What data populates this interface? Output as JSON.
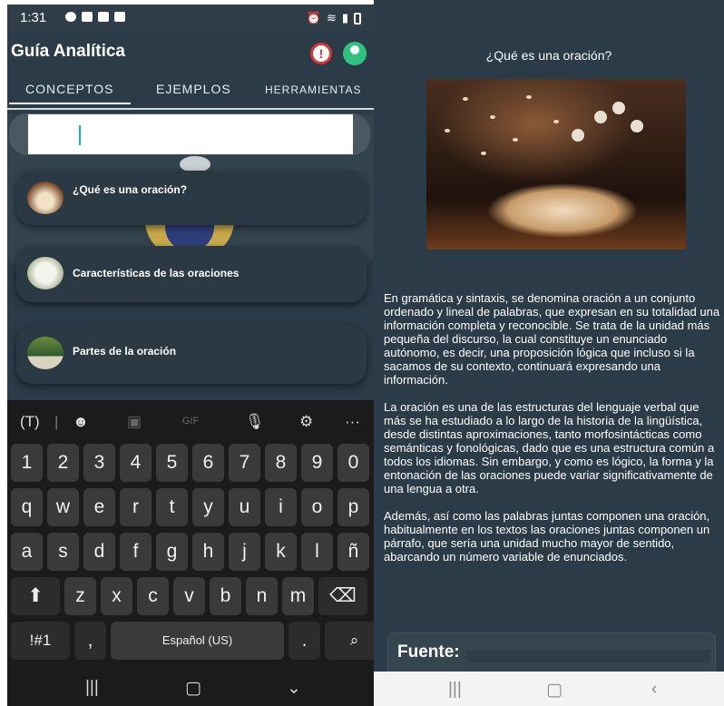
{
  "left": {
    "statusbar": {
      "time": "1:31"
    },
    "app": {
      "title": "Guía Analítica"
    },
    "tabs": [
      "CONCEPTOS",
      "EJEMPLOS",
      "HERRAMIENTAS"
    ],
    "search": {
      "value": ""
    },
    "cards": [
      {
        "label": "¿Qué es una oración?"
      },
      {
        "label": "Características de las oraciones"
      },
      {
        "label": "Partes de la oración"
      }
    ],
    "keyboard": {
      "row_numbers": [
        "1",
        "2",
        "3",
        "4",
        "5",
        "6",
        "7",
        "8",
        "9",
        "0"
      ],
      "row_q": [
        "q",
        "w",
        "e",
        "r",
        "t",
        "y",
        "u",
        "i",
        "o",
        "p"
      ],
      "row_a": [
        "a",
        "s",
        "d",
        "f",
        "g",
        "h",
        "j",
        "k",
        "l",
        "ñ"
      ],
      "row_z": [
        "z",
        "x",
        "c",
        "v",
        "b",
        "n",
        "m"
      ],
      "symbols_key": "!#1",
      "comma_key": ",",
      "space_key": "Español (US)",
      "period_key": ".",
      "toolbar": {
        "gif": "GIF"
      }
    },
    "colors": {
      "background": "#2b3b47",
      "accent": "#17b5a5",
      "keyboard": "#1b1b1b"
    }
  },
  "right": {
    "article": {
      "title": "¿Qué es una oración?",
      "paragraphs": [
        "En gramática y sintaxis, se denomina oración a un conjunto ordenado y lineal de palabras, que expresan en su totalidad una información completa y reconocible. Se trata de la unidad más pequeña del discurso, la cual constituye un enunciado autónomo, es decir, una proposición lógica que incluso si la sacamos de su contexto, continuará expresando una información.",
        "La oración es una de las estructuras del lenguaje verbal que más se ha estudiado a lo largo de la historia de la lingüística, desde distintas aproximaciones, tanto morfosintácticas como semánticas y fonológicas, dado que es una estructura común a todos los idiomas. Sin embargo, y como es lógico, la forma y la entonación de las oraciones puede variar significativamente de una lengua a otra.",
        "Además, así como las palabras juntas componen una oración, habitualmente en los textos las oraciones juntas componen un párrafo, que sería una unidad mucho mayor de sentido, abarcando un número variable de enunciados."
      ],
      "source_label": "Fuente:"
    }
  }
}
